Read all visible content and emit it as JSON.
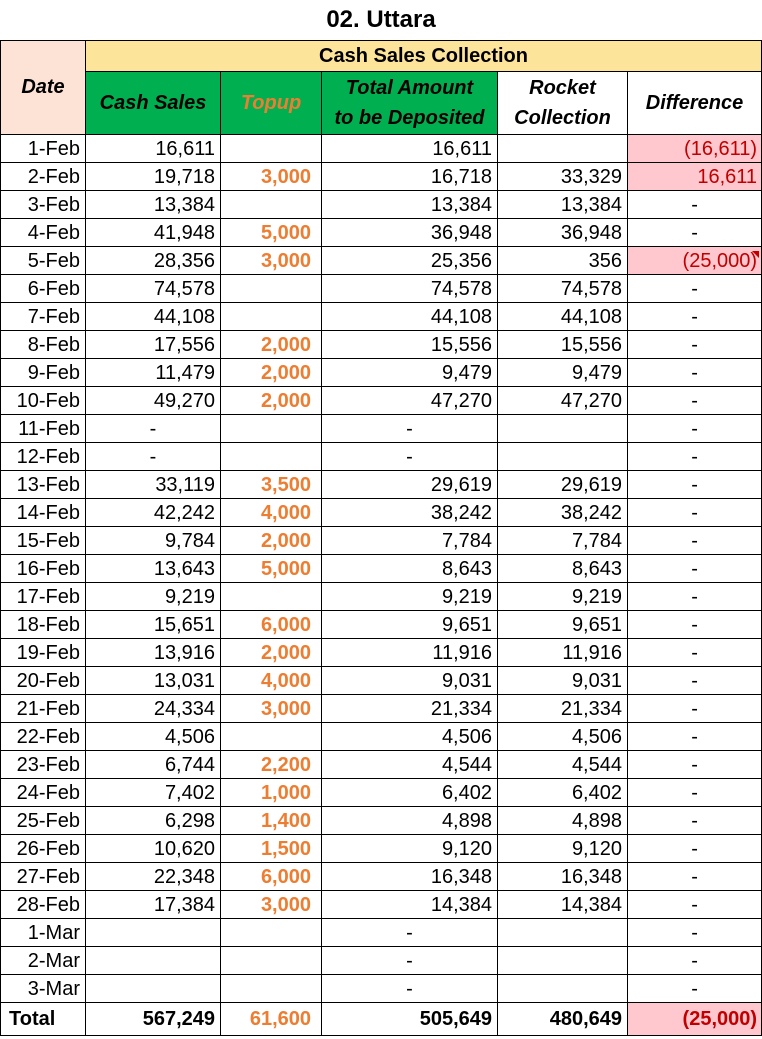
{
  "title": "02. Uttara",
  "headers": {
    "date": "Date",
    "group": "Cash Sales Collection",
    "cash_sales": "Cash Sales",
    "topup": "Topup",
    "total_line1": "Total Amount",
    "total_line2": "to be Deposited",
    "rocket_line1": "Rocket",
    "rocket_line2": "Collection",
    "difference": "Difference"
  },
  "rows": [
    {
      "date": "1-Feb",
      "cash": "16,611",
      "topup": "",
      "total": "16,611",
      "rocket": "",
      "diff": "(16,611)",
      "highlight": true
    },
    {
      "date": "2-Feb",
      "cash": "19,718",
      "topup": "3,000",
      "total": "16,718",
      "rocket": "33,329",
      "diff": "16,611",
      "highlight": true
    },
    {
      "date": "3-Feb",
      "cash": "13,384",
      "topup": "",
      "total": "13,384",
      "rocket": "13,384",
      "diff": "-",
      "highlight": false
    },
    {
      "date": "4-Feb",
      "cash": "41,948",
      "topup": "5,000",
      "total": "36,948",
      "rocket": "36,948",
      "diff": "-",
      "highlight": false
    },
    {
      "date": "5-Feb",
      "cash": "28,356",
      "topup": "3,000",
      "total": "25,356",
      "rocket": "356",
      "diff": "(25,000)",
      "highlight": true
    },
    {
      "date": "6-Feb",
      "cash": "74,578",
      "topup": "",
      "total": "74,578",
      "rocket": "74,578",
      "diff": "-",
      "highlight": false
    },
    {
      "date": "7-Feb",
      "cash": "44,108",
      "topup": "",
      "total": "44,108",
      "rocket": "44,108",
      "diff": "-",
      "highlight": false
    },
    {
      "date": "8-Feb",
      "cash": "17,556",
      "topup": "2,000",
      "total": "15,556",
      "rocket": "15,556",
      "diff": "-",
      "highlight": false
    },
    {
      "date": "9-Feb",
      "cash": "11,479",
      "topup": "2,000",
      "total": "9,479",
      "rocket": "9,479",
      "diff": "-",
      "highlight": false
    },
    {
      "date": "10-Feb",
      "cash": "49,270",
      "topup": "2,000",
      "total": "47,270",
      "rocket": "47,270",
      "diff": "-",
      "highlight": false
    },
    {
      "date": "11-Feb",
      "cash": "-",
      "topup": "",
      "total": "-",
      "rocket": "",
      "diff": "-",
      "highlight": false
    },
    {
      "date": "12-Feb",
      "cash": "-",
      "topup": "",
      "total": "-",
      "rocket": "",
      "diff": "-",
      "highlight": false
    },
    {
      "date": "13-Feb",
      "cash": "33,119",
      "topup": "3,500",
      "total": "29,619",
      "rocket": "29,619",
      "diff": "-",
      "highlight": false
    },
    {
      "date": "14-Feb",
      "cash": "42,242",
      "topup": "4,000",
      "total": "38,242",
      "rocket": "38,242",
      "diff": "-",
      "highlight": false
    },
    {
      "date": "15-Feb",
      "cash": "9,784",
      "topup": "2,000",
      "total": "7,784",
      "rocket": "7,784",
      "diff": "-",
      "highlight": false
    },
    {
      "date": "16-Feb",
      "cash": "13,643",
      "topup": "5,000",
      "total": "8,643",
      "rocket": "8,643",
      "diff": "-",
      "highlight": false
    },
    {
      "date": "17-Feb",
      "cash": "9,219",
      "topup": "",
      "total": "9,219",
      "rocket": "9,219",
      "diff": "-",
      "highlight": false
    },
    {
      "date": "18-Feb",
      "cash": "15,651",
      "topup": "6,000",
      "total": "9,651",
      "rocket": "9,651",
      "diff": "-",
      "highlight": false
    },
    {
      "date": "19-Feb",
      "cash": "13,916",
      "topup": "2,000",
      "total": "11,916",
      "rocket": "11,916",
      "diff": "-",
      "highlight": false
    },
    {
      "date": "20-Feb",
      "cash": "13,031",
      "topup": "4,000",
      "total": "9,031",
      "rocket": "9,031",
      "diff": "-",
      "highlight": false
    },
    {
      "date": "21-Feb",
      "cash": "24,334",
      "topup": "3,000",
      "total": "21,334",
      "rocket": "21,334",
      "diff": "-",
      "highlight": false
    },
    {
      "date": "22-Feb",
      "cash": "4,506",
      "topup": "",
      "total": "4,506",
      "rocket": "4,506",
      "diff": "-",
      "highlight": false
    },
    {
      "date": "23-Feb",
      "cash": "6,744",
      "topup": "2,200",
      "total": "4,544",
      "rocket": "4,544",
      "diff": "-",
      "highlight": false
    },
    {
      "date": "24-Feb",
      "cash": "7,402",
      "topup": "1,000",
      "total": "6,402",
      "rocket": "6,402",
      "diff": "-",
      "highlight": false
    },
    {
      "date": "25-Feb",
      "cash": "6,298",
      "topup": "1,400",
      "total": "4,898",
      "rocket": "4,898",
      "diff": "-",
      "highlight": false
    },
    {
      "date": "26-Feb",
      "cash": "10,620",
      "topup": "1,500",
      "total": "9,120",
      "rocket": "9,120",
      "diff": "-",
      "highlight": false
    },
    {
      "date": "27-Feb",
      "cash": "22,348",
      "topup": "6,000",
      "total": "16,348",
      "rocket": "16,348",
      "diff": "-",
      "highlight": false
    },
    {
      "date": "28-Feb",
      "cash": "17,384",
      "topup": "3,000",
      "total": "14,384",
      "rocket": "14,384",
      "diff": "-",
      "highlight": false
    },
    {
      "date": "1-Mar",
      "cash": "",
      "topup": "",
      "total": "-",
      "rocket": "",
      "diff": "-",
      "highlight": false
    },
    {
      "date": "2-Mar",
      "cash": "",
      "topup": "",
      "total": "-",
      "rocket": "",
      "diff": "-",
      "highlight": false
    },
    {
      "date": "3-Mar",
      "cash": "",
      "topup": "",
      "total": "-",
      "rocket": "",
      "diff": "-",
      "highlight": false
    }
  ],
  "totals": {
    "label": "Total",
    "cash": "567,249",
    "topup": "61,600",
    "total": "505,649",
    "rocket": "480,649",
    "diff": "(25,000)"
  },
  "colors": {
    "header_green": "#00b050",
    "header_yellow": "#fde49b",
    "date_header": "#fde3d5",
    "topup_text": "#ed7d31",
    "negative_fill": "#ffc7ce",
    "negative_text": "#c00000"
  }
}
